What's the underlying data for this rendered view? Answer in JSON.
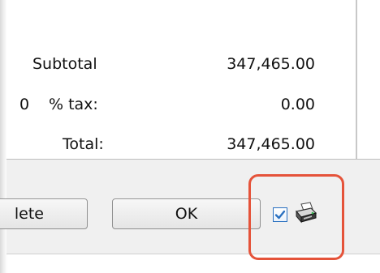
{
  "totals": {
    "subtotal_label": "Subtotal",
    "subtotal_value": "347,465.00",
    "tax_rate": "0",
    "tax_label": "% tax:",
    "tax_value": "0.00",
    "total_label": "Total:",
    "total_value": "347,465.00"
  },
  "buttons": {
    "delete_label_visible": "lete",
    "ok_label": "OK"
  },
  "controls": {
    "print_checkbox_checked": true
  },
  "icons": {
    "checkbox_check": "check-icon",
    "printer": "printer-icon"
  },
  "colors": {
    "highlight": "#e5533a",
    "checkbox_accent": "#2a70c0"
  }
}
